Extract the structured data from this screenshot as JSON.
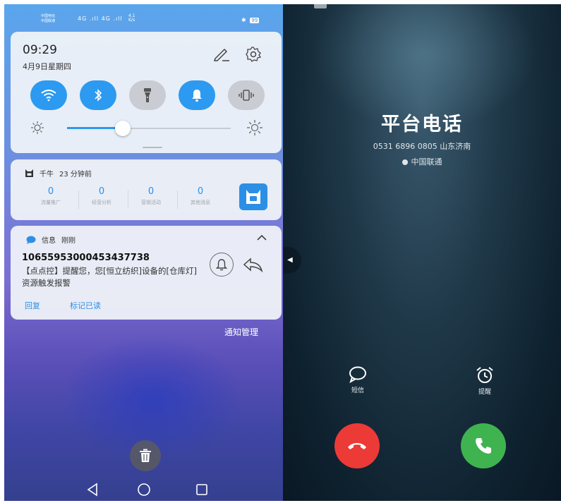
{
  "left": {
    "statusbar": {
      "carrier_1": "中国电信",
      "carrier_2": "中国联通",
      "signal": "4G .ıll 4G .ıll",
      "speed_value": "4.1",
      "speed_unit": "K/s",
      "battery": "99"
    },
    "quick_settings": {
      "time": "09:29",
      "date": "4月9日星期四",
      "brightness_level": 0.34,
      "tiles": [
        {
          "name": "wifi",
          "on": true
        },
        {
          "name": "bluetooth",
          "on": true
        },
        {
          "name": "flashlight",
          "on": false
        },
        {
          "name": "ring",
          "on": true
        },
        {
          "name": "vibrate",
          "on": false
        }
      ]
    },
    "qianniu": {
      "app": "千牛",
      "time": "23 分钟前",
      "stats": [
        {
          "value": "0",
          "label": "流量推广"
        },
        {
          "value": "0",
          "label": "经营分析"
        },
        {
          "value": "0",
          "label": "营销活动"
        },
        {
          "value": "0",
          "label": "其他消息"
        }
      ]
    },
    "sms": {
      "app": "信息",
      "time": "刚刚",
      "sender": "10655953000453437738",
      "body": "【点点控】提醒您，您[恒立纺织]设备的[仓库灯]资源触发报警",
      "action_reply": "回复",
      "action_mark_read": "标记已读"
    },
    "manage": "通知管理"
  },
  "right": {
    "caller_name": "平台电话",
    "caller_number": "0531 6896 0805  山东济南",
    "carrier": "中国联通",
    "options": [
      {
        "icon": "message-icon",
        "label": "短信"
      },
      {
        "icon": "alarm-icon",
        "label": "提醒"
      }
    ]
  },
  "colors": {
    "accent": "#2c9af0",
    "decline": "#ec3a37",
    "answer": "#3fb34f"
  }
}
